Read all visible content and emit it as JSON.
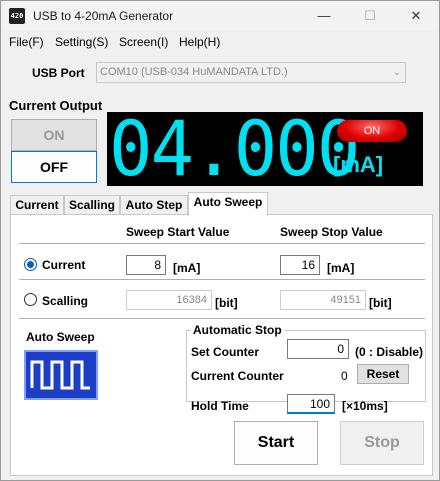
{
  "window": {
    "icon_text": "420",
    "title": "USB to 4-20mA Generator",
    "min_glyph": "—",
    "max_glyph": "☐",
    "close_glyph": "✕"
  },
  "menu": [
    "File(F)",
    "Setting(S)",
    "Screen(I)",
    "Help(H)"
  ],
  "usb": {
    "label": "USB Port",
    "selected": "COM10 (USB-034 HuMANDATA LTD.)"
  },
  "output": {
    "section_title": "Current Output",
    "on_label": "ON",
    "off_label": "OFF",
    "display_value": "04.000",
    "led_label": "ON",
    "unit": "[mA]"
  },
  "tabs": [
    "Current",
    "Scalling",
    "Auto Step",
    "Auto Sweep"
  ],
  "active_tab": "Auto Sweep",
  "sweep": {
    "start_header": "Sweep Start Value",
    "stop_header": "Sweep Stop Value",
    "current": {
      "label": "Current",
      "start": "8",
      "stop": "16",
      "unit": "[mA]"
    },
    "scalling": {
      "label": "Scalling",
      "start": "16384",
      "stop": "49151",
      "unit": "[bit]"
    }
  },
  "auto_sweep_label": "Auto Sweep",
  "auto_stop": {
    "title": "Automatic Stop",
    "set_counter_label": "Set Counter",
    "set_counter_value": "0",
    "set_counter_hint": "(0 : Disable)",
    "current_counter_label": "Current Counter",
    "current_counter_value": "0",
    "reset_label": "Reset"
  },
  "hold_time": {
    "label": "Hold Time",
    "value": "100",
    "unit": "[×10ms]"
  },
  "actions": {
    "start_label": "Start",
    "stop_label": "Stop"
  },
  "colors": {
    "display_bg": "#000000",
    "display_digits": "#00e0f0",
    "led_red": "#e00000",
    "sweep_icon_bg": "#1d3fc8",
    "radio_accent": "#0060c0"
  }
}
